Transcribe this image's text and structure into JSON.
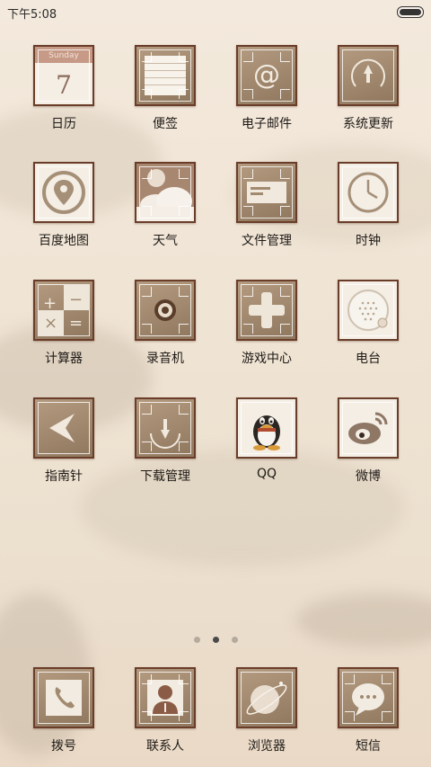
{
  "status_bar": {
    "time": "下午5:08"
  },
  "apps": [
    {
      "label": "日历",
      "sub": "Sunday",
      "day": "7"
    },
    {
      "label": "便签"
    },
    {
      "label": "电子邮件",
      "glyph": "@"
    },
    {
      "label": "系统更新"
    },
    {
      "label": "百度地图"
    },
    {
      "label": "天气"
    },
    {
      "label": "文件管理"
    },
    {
      "label": "时钟"
    },
    {
      "label": "计算器"
    },
    {
      "label": "录音机"
    },
    {
      "label": "游戏中心"
    },
    {
      "label": "电台"
    },
    {
      "label": "指南针"
    },
    {
      "label": "下载管理"
    },
    {
      "label": "QQ"
    },
    {
      "label": "微博"
    }
  ],
  "dock": [
    {
      "label": "拨号"
    },
    {
      "label": "联系人"
    },
    {
      "label": "浏览器"
    },
    {
      "label": "短信"
    }
  ],
  "pager": {
    "pages": 3,
    "current": 2
  }
}
